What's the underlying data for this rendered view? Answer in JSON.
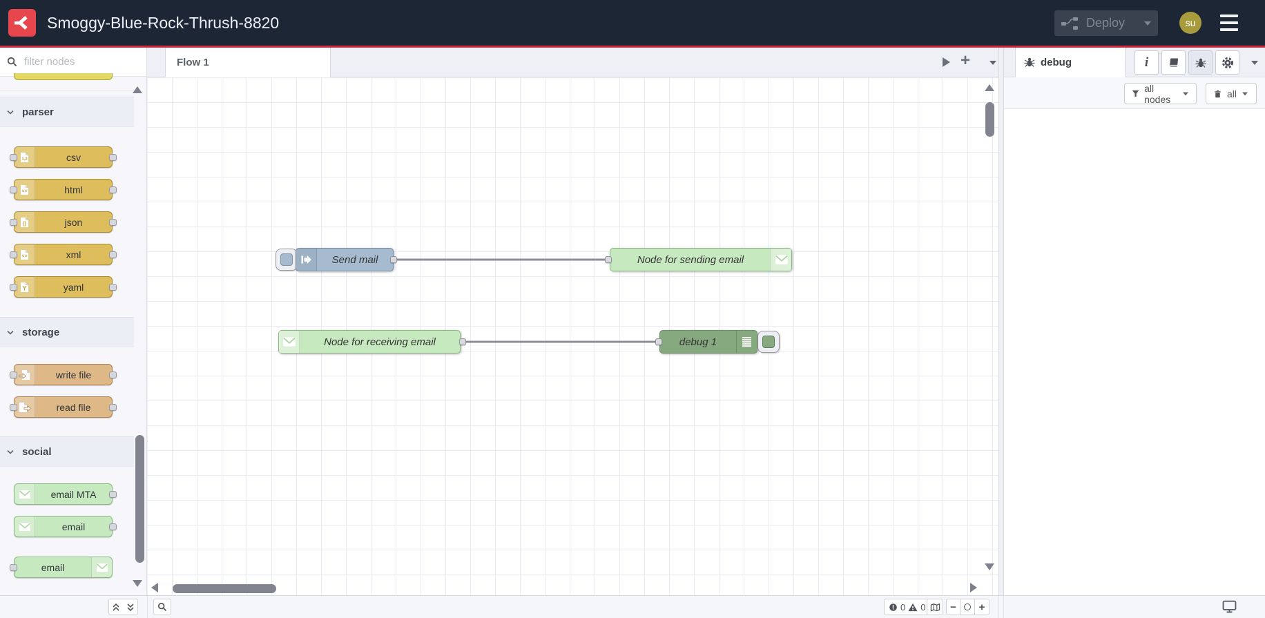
{
  "header": {
    "title": "Smoggy-Blue-Rock-Thrush-8820",
    "deploy_label": "Deploy",
    "avatar_text": "su"
  },
  "palette": {
    "filter_placeholder": "filter nodes",
    "categories": [
      {
        "label": "parser",
        "nodes": [
          {
            "label": "csv"
          },
          {
            "label": "html"
          },
          {
            "label": "json"
          },
          {
            "label": "xml"
          },
          {
            "label": "yaml"
          }
        ]
      },
      {
        "label": "storage",
        "nodes": [
          {
            "label": "write file"
          },
          {
            "label": "read file"
          }
        ]
      },
      {
        "label": "social",
        "nodes": [
          {
            "label": "email MTA"
          },
          {
            "label": "email"
          },
          {
            "label": "email"
          }
        ]
      }
    ]
  },
  "workspace": {
    "tabs": [
      {
        "label": "Flow 1",
        "active": true
      }
    ]
  },
  "canvas": {
    "nodes": [
      {
        "label": "Send mail",
        "type": "inject"
      },
      {
        "label": "Node for sending email",
        "type": "email-out"
      },
      {
        "label": "Node for receiving email",
        "type": "email-in"
      },
      {
        "label": "debug 1",
        "type": "debug"
      }
    ]
  },
  "sidebar": {
    "tab_label": "debug",
    "filter_button": "all nodes",
    "clear_button": "all"
  },
  "footer": {
    "error_count": "0",
    "warning_count": "0"
  },
  "colors": {
    "header_bg": "#1d2634",
    "accent_red": "#d2273e",
    "logo_red": "#e8464d",
    "avatar_gold": "#a89b3d",
    "inject_node": "#a6bbcf",
    "email_node": "#c7e9c0",
    "debug_node": "#87a980",
    "parser_node": "#debd5c",
    "storage_node": "#deb887",
    "partial_node": "#e4da63"
  }
}
